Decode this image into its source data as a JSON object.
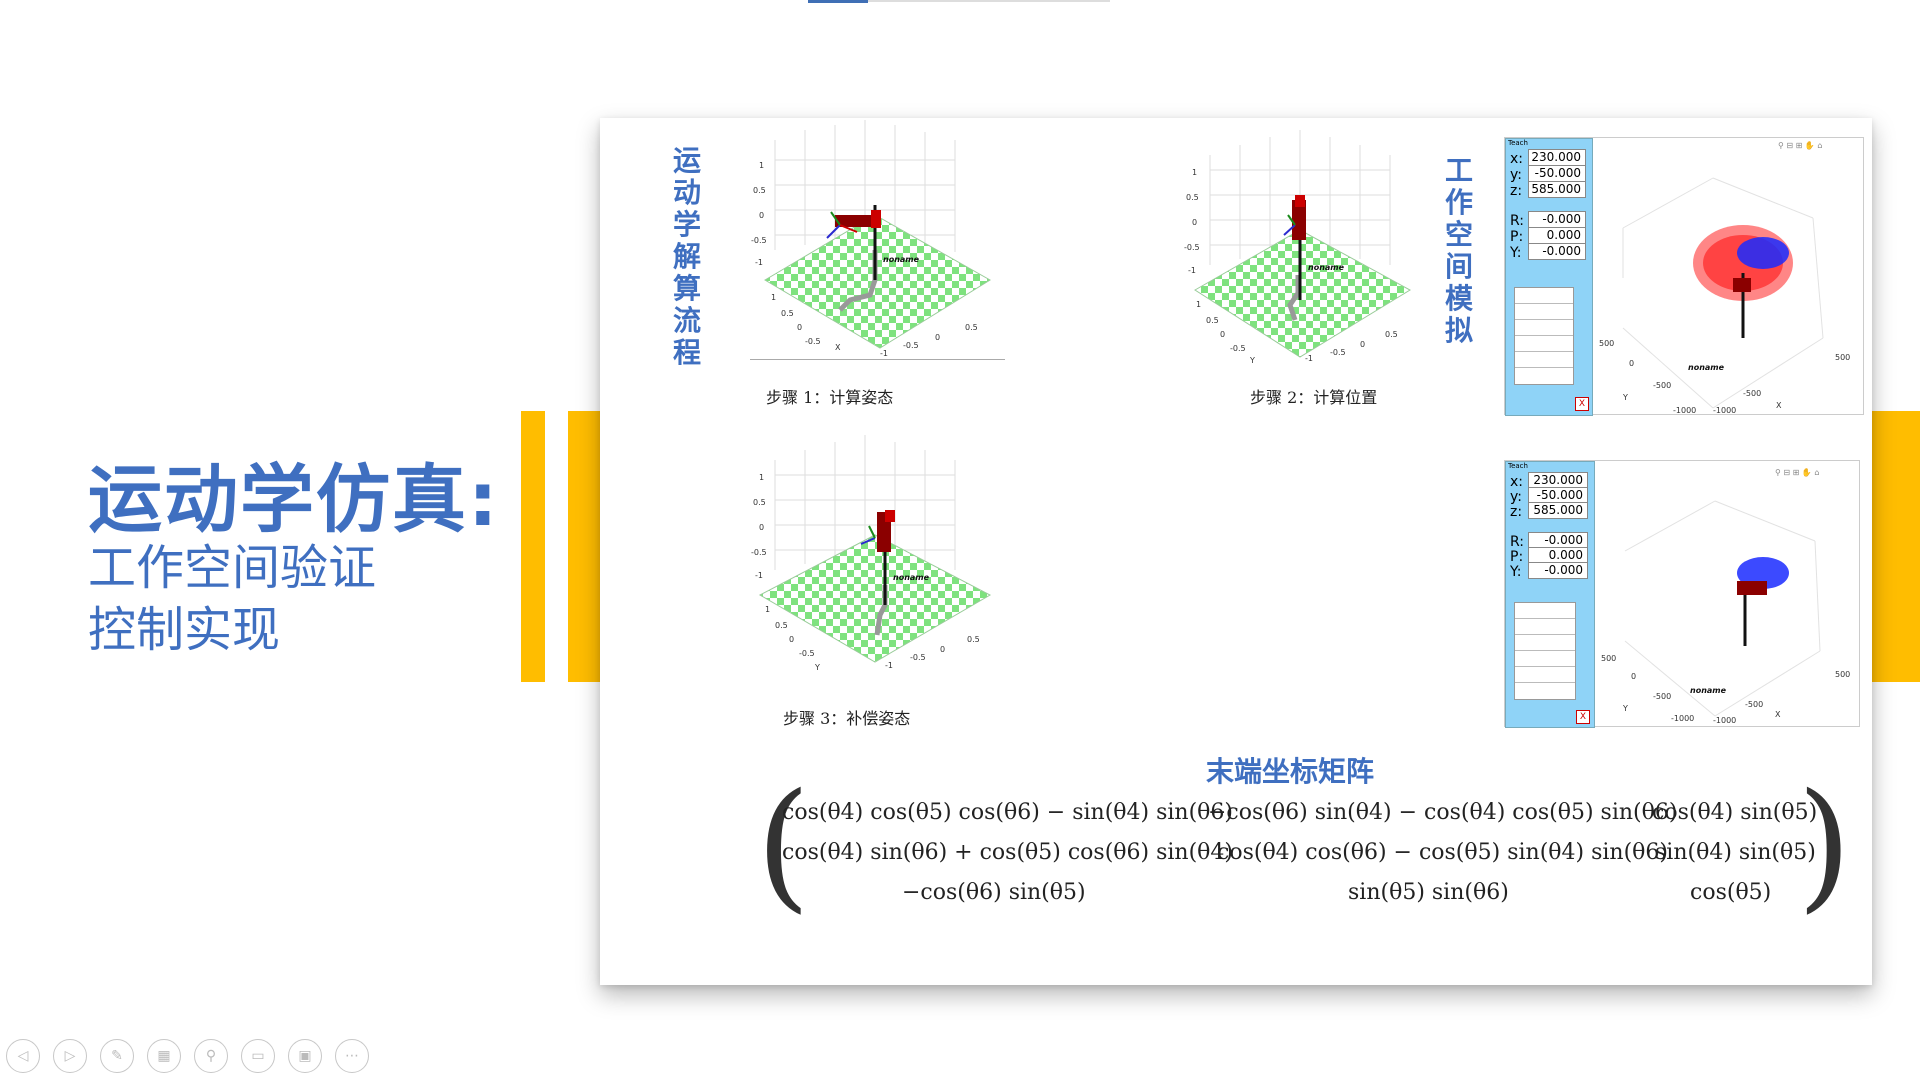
{
  "slide": {
    "title": "运动学仿真:",
    "subtitle_1": "工作空间验证",
    "subtitle_2": "控制实现",
    "progress": 0.2
  },
  "card": {
    "left_vertical_label": "运动学解算流程",
    "right_vertical_label": "工作空间模拟",
    "step1_caption": "步骤 1：计算姿态",
    "step2_caption": "步骤 2：计算位置",
    "step3_caption": "步骤 3：补偿姿态",
    "plot_label": "noname",
    "matrix_title": "末端坐标矩阵",
    "matrix": [
      [
        "cos(θ4) cos(θ5) cos(θ6) − sin(θ4) sin(θ6)",
        "−cos(θ6) sin(θ4) − cos(θ4) cos(θ5) sin(θ6)",
        "cos(θ4) sin(θ5)"
      ],
      [
        "cos(θ4) sin(θ6) + cos(θ5) cos(θ6) sin(θ4)",
        "cos(θ4) cos(θ6) − cos(θ5) sin(θ4) sin(θ6)",
        "sin(θ4) sin(θ5)"
      ],
      [
        "−cos(θ6) sin(θ5)",
        "sin(θ5) sin(θ6)",
        "cos(θ5)"
      ]
    ]
  },
  "teach_panel": {
    "header": "Teach",
    "x_label": "x:",
    "x_value": "230.000",
    "y_label": "y:",
    "y_value": "-50.000",
    "z_label": "z:",
    "z_value": "585.000",
    "r_label": "R:",
    "r_value": "-0.000",
    "p_label": "P:",
    "p_value": "0.000",
    "yaw_label": "Y:",
    "yaw_value": "-0.000",
    "close_label": "X"
  },
  "axes": {
    "z_ticks": [
      "1",
      "0.5",
      "0",
      "-0.5",
      "-1"
    ],
    "x_ticks": [
      "1",
      "0.5",
      "0",
      "-0.5",
      "-1"
    ],
    "y_ticks": [
      "0.5",
      "0",
      "-0.5",
      "-1"
    ],
    "x_axis": "X",
    "y_axis": "Y",
    "ws_ticks_a": [
      "500",
      "0",
      "-500",
      "-1000"
    ],
    "ws_ticks_b": [
      "500",
      "0",
      "-500",
      "-1000"
    ]
  },
  "colors": {
    "accent": "#3f6fc0",
    "bar": "#ffbd00"
  },
  "toolbar": [
    "prev-icon",
    "next-icon",
    "pen-icon",
    "slides-icon",
    "zoom-icon",
    "subtitle-icon",
    "camera-off-icon",
    "more-icon"
  ]
}
